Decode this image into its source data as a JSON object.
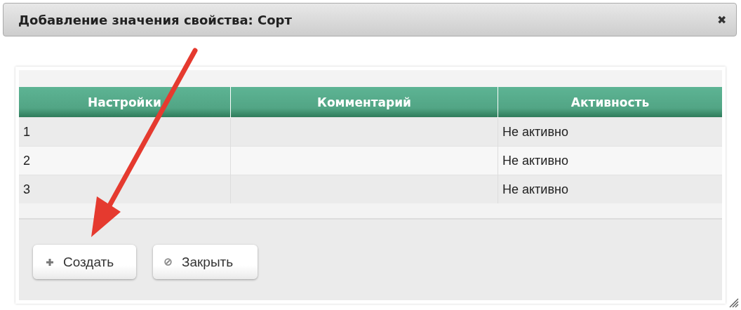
{
  "dialog": {
    "title": "Добавление значения свойства: Сорт",
    "close": "✖"
  },
  "table": {
    "columns": [
      "Настройки",
      "Комментарий",
      "Активность"
    ],
    "rows": [
      {
        "cells": [
          "1",
          "",
          "Не активно"
        ]
      },
      {
        "cells": [
          "2",
          "",
          "Не активно"
        ]
      },
      {
        "cells": [
          "3",
          "",
          "Не активно"
        ]
      }
    ]
  },
  "buttons": [
    {
      "kind": "create",
      "label": "Создать"
    },
    {
      "kind": "close",
      "label": "Закрыть"
    }
  ]
}
